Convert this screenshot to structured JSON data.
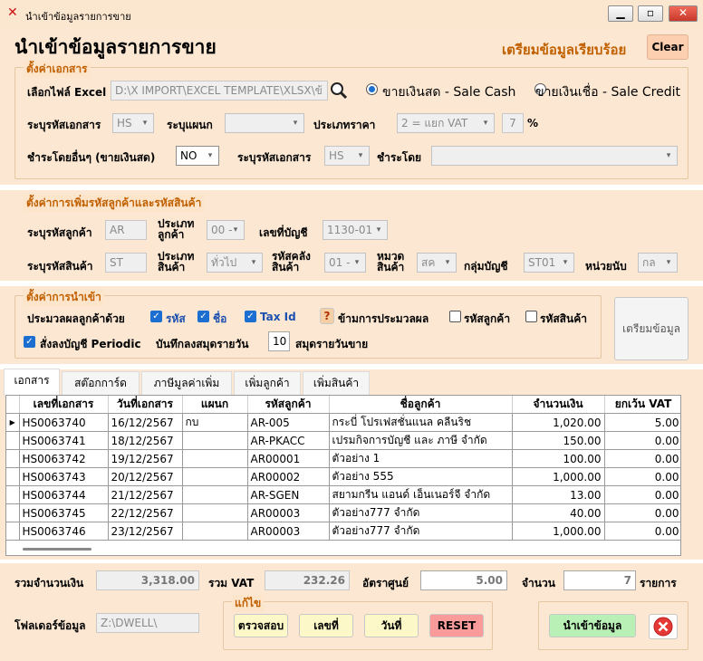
{
  "window": {
    "title": "นำเข้าข้อมูลรายการขาย"
  },
  "header": {
    "title": "นำเข้าข้อมูลรายการขาย",
    "status": "เตรียมข้อมูลเรียบร้อย",
    "clear_label": "Clear"
  },
  "doc_settings": {
    "legend": "ตั้งค่าเอกสาร",
    "file_label": "เลือกไฟล์ Excel",
    "file_value": "D:\\X IMPORT\\EXCEL TEMPLATE\\XLSX\\ข้",
    "sale_cash_label": "ขายเงินสด - Sale Cash",
    "sale_credit_label": "ขายเงินเชื่อ - Sale Credit",
    "doc_code_label": "ระบุรหัสเอกสาร",
    "doc_code_value": "HS",
    "dept_label": "ระบุแผนก",
    "dept_value": "",
    "price_type_label": "ประเภทราคา",
    "price_type_value": "2 = แยก VAT",
    "vat_rate": "7",
    "percent_sign": "%",
    "other_pay_label": "ชำระโดยอื่นๆ (ขายเงินสด)",
    "other_pay_value": "NO",
    "doc_code2_label": "ระบุรหัสเอกสาร",
    "doc_code2_value": "HS",
    "pay_by_label": "ชำระโดย",
    "pay_by_value": ""
  },
  "code_settings": {
    "legend": "ตั้งค่าการเพิ่มรหัสลูกค้าและรหัสสินค้า",
    "cust_code_label": "ระบุรหัสลูกค้า",
    "cust_code_value": "AR",
    "cust_type_label1": "ประเภท",
    "cust_type_label2": "ลูกค้า",
    "cust_type_value": "00 -",
    "acct_no_label": "เลขที่บัญชี",
    "acct_no_value": "1130-01",
    "prod_code_label": "ระบุรหัสสินค้า",
    "prod_code_value": "ST",
    "prod_type_label1": "ประเภท",
    "prod_type_label2": "สินค้า",
    "prod_type_value": "ทั่วไป",
    "wh_label1": "รหัสคลัง",
    "wh_label2": "สินค้า",
    "wh_value": "01 -",
    "cat_label1": "หมวด",
    "cat_label2": "สินค้า",
    "cat_value": "สค",
    "acct_group_label": "กลุ่มบัญชี",
    "acct_group_value": "ST01",
    "unit_label": "หน่วยนับ",
    "unit_value": "กล"
  },
  "import_settings": {
    "legend": "ตั้งค่าการนำเข้า",
    "process_label": "ประมวลผลลูกค้าด้วย",
    "opt_code": "รหัส",
    "opt_name": "ชื่อ",
    "opt_taxid": "Tax Id",
    "help_label": "?",
    "skip_label": "ข้ามการประมวลผล",
    "skip_cust": "รหัสลูกค้า",
    "skip_prod": "รหัสสินค้า",
    "periodic_label": "สั่งลงบัญชี Periodic",
    "daily_label": "บันทึกลงสมุดรายวัน",
    "daily_value": "10",
    "journal_label": "สมุดรายวันขาย",
    "prepare_label": "เตรียมข้อมูล"
  },
  "tabs": [
    "เอกสาร",
    "สต๊อกการ์ด",
    "ภาษีมูลค่าเพิ่ม",
    "เพิ่มลูกค้า",
    "เพิ่มสินค้า"
  ],
  "table": {
    "columns": [
      "เลขที่เอกสาร",
      "วันที่เอกสาร",
      "แผนก",
      "รหัสลูกค้า",
      "ชื่อลูกค้า",
      "จำนวนเงิน",
      "ยกเว้น VAT"
    ],
    "rows": [
      [
        "HS0063740",
        "16/12/2567",
        "กบ",
        "AR-005",
        "กระบี่ โปรเฟสชั่นแนล คลีนริช",
        "1,020.00",
        "5.00"
      ],
      [
        "HS0063741",
        "18/12/2567",
        "",
        "AR-PKACC",
        "เปรมกิจการบัญชี และ ภาษี จำกัด",
        "150.00",
        "0.00"
      ],
      [
        "HS0063742",
        "19/12/2567",
        "",
        "AR00001",
        "ตัวอย่าง 1",
        "100.00",
        "0.00"
      ],
      [
        "HS0063743",
        "20/12/2567",
        "",
        "AR00002",
        "ตัวอย่าง 555",
        "1,000.00",
        "0.00"
      ],
      [
        "HS0063744",
        "21/12/2567",
        "",
        "AR-SGEN",
        "สยามกรีน แอนด์ เอ็นเนอร์จี จำกัด",
        "13.00",
        "0.00"
      ],
      [
        "HS0063745",
        "22/12/2567",
        "",
        "AR00003",
        "ตัวอย่าง777 จำกัด",
        "40.00",
        "0.00"
      ],
      [
        "HS0063746",
        "23/12/2567",
        "",
        "AR00003",
        "ตัวอย่าง777 จำกัด",
        "1,000.00",
        "0.00"
      ]
    ]
  },
  "summary": {
    "total_label": "รวมจำนวนเงิน",
    "total_value": "3,318.00",
    "vat_label": "รวม VAT",
    "vat_value": "232.26",
    "zero_label": "อัตราศูนย์",
    "zero_value": "5.00",
    "count_label": "จำนวน",
    "count_value": "7",
    "items_label": "รายการ"
  },
  "footer": {
    "folder_label": "โฟลเดอร์ข้อมูล",
    "folder_value": "Z:\\DWELL\\",
    "edit_legend": "แก้ไข",
    "check_label": "ตรวจสอบ",
    "number_label": "เลขที่",
    "date_label": "วันที่",
    "reset_label": "RESET",
    "import_label": "นำเข้าข้อมูล"
  },
  "colors": {
    "accent": "#c06000",
    "panel": "#fde5cc",
    "check_blue": "#1c6fd1"
  }
}
